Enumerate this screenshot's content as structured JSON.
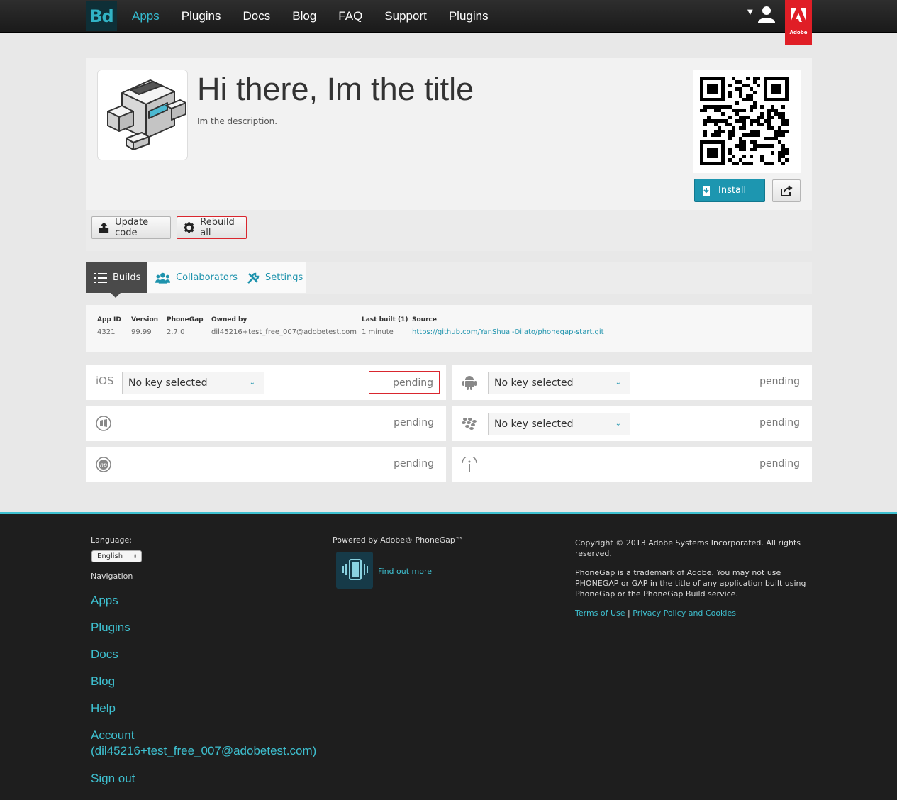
{
  "nav": {
    "logo": "Bd",
    "items": [
      {
        "label": "Apps",
        "active": true
      },
      {
        "label": "Plugins",
        "active": false
      },
      {
        "label": "Docs",
        "active": false
      },
      {
        "label": "Blog",
        "active": false
      },
      {
        "label": "FAQ",
        "active": false
      },
      {
        "label": "Support",
        "active": false
      },
      {
        "label": "Plugins",
        "active": false
      }
    ],
    "adobe_label": "Adobe",
    "accent": "#35bbd0"
  },
  "app": {
    "title": "Hi there, Im the title",
    "description": "Im the description.",
    "install_label": "Install",
    "update_label": "Update code",
    "rebuild_label": "Rebuild all"
  },
  "tabs": [
    {
      "label": "Builds",
      "icon": "list-icon",
      "active": true
    },
    {
      "label": "Collaborators",
      "icon": "people-icon",
      "active": false
    },
    {
      "label": "Settings",
      "icon": "wrench-icon",
      "active": false
    }
  ],
  "meta": {
    "app_id": {
      "label": "App ID",
      "value": "4321"
    },
    "version": {
      "label": "Version",
      "value": "99.99"
    },
    "phonegap": {
      "label": "PhoneGap",
      "value": "2.7.0"
    },
    "owner": {
      "label": "Owned by",
      "value": "dil45216+test_free_007@adobetest.com"
    },
    "last_built": {
      "label": "Last built (1)",
      "value": "1 minute"
    },
    "source": {
      "label": "Source",
      "value": "https://github.com/YanShuai-Dilato/phonegap-start.git"
    }
  },
  "builds": [
    {
      "platform": "ios",
      "platform_text": "iOS",
      "key": "No key selected",
      "status": "pending"
    },
    {
      "platform": "android",
      "key": "No key selected",
      "status": "pending"
    },
    {
      "platform": "windows",
      "status": "pending"
    },
    {
      "platform": "blackberry",
      "key": "No key selected",
      "status": "pending"
    },
    {
      "platform": "webos",
      "status": "pending"
    },
    {
      "platform": "symbian",
      "status": "pending"
    }
  ],
  "footer": {
    "language_label": "Language:",
    "language_value": "English",
    "navigation_label": "Navigation",
    "links": [
      "Apps",
      "Plugins",
      "Docs",
      "Blog",
      "Help",
      "Account (dil45216+test_free_007@adobetest.com)",
      "Sign out"
    ],
    "powered_by": "Powered by Adobe® PhoneGap™",
    "find_out_more": "Find out more",
    "copyright": "Copyright © 2013 Adobe Systems Incorporated. All rights reserved.",
    "trademark": "PhoneGap is a trademark of Adobe. You may not use PHONEGAP or GAP in the title of any application built using PhoneGap or the PhoneGap Build service.",
    "terms": "Terms of Use",
    "privacy": "Privacy Policy and Cookies"
  }
}
